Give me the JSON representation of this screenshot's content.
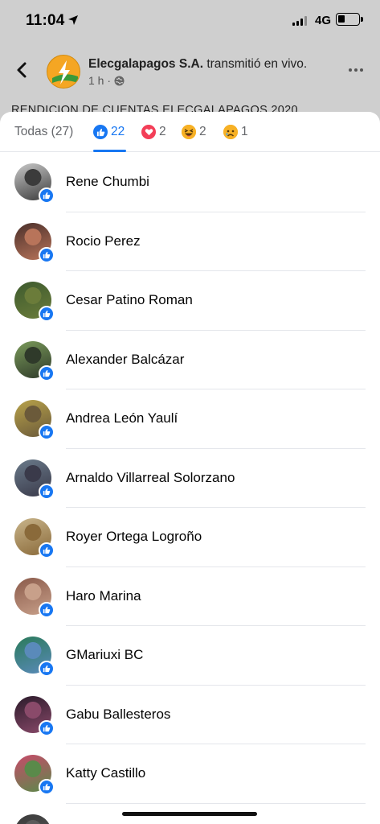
{
  "status_bar": {
    "time": "11:04",
    "network": "4G",
    "battery_level": 0.25
  },
  "post": {
    "page_name": "Elecgalapagos S.A.",
    "action": "transmitió en vivo.",
    "time_ago": "1 h ·",
    "caption": "RENDICION DE CUENTAS ELECGALAPAGOS 2020"
  },
  "tabs": {
    "all_label": "Todas (27)",
    "like_count": "22",
    "love_count": "2",
    "haha_count": "2",
    "sad_count": "1"
  },
  "colors": {
    "like": "#1877f2",
    "love": "#f33e58",
    "haha": "#f7b125"
  },
  "reactors": [
    {
      "name": "Rene Chumbi",
      "avatar_colors": [
        "#c9c9c9",
        "#3b3b3b"
      ],
      "reaction": "like"
    },
    {
      "name": "Rocio Perez",
      "avatar_colors": [
        "#4a2f2a",
        "#b8745a"
      ],
      "reaction": "like"
    },
    {
      "name": "Cesar Patino Roman",
      "avatar_colors": [
        "#3d5a2e",
        "#6b7c3a"
      ],
      "reaction": "like"
    },
    {
      "name": "Alexander Balcázar",
      "avatar_colors": [
        "#7a9a5a",
        "#2f3a2a"
      ],
      "reaction": "like"
    },
    {
      "name": "Andrea León Yaulí",
      "avatar_colors": [
        "#b8a24a",
        "#6b5a3a"
      ],
      "reaction": "like"
    },
    {
      "name": "Arnaldo Villarreal Solorzano",
      "avatar_colors": [
        "#6a7a8a",
        "#3a3a4a"
      ],
      "reaction": "like"
    },
    {
      "name": "Royer Ortega Logroño",
      "avatar_colors": [
        "#c8b48a",
        "#8a6a3a"
      ],
      "reaction": "like"
    },
    {
      "name": "Haro Marina",
      "avatar_colors": [
        "#8a5a4a",
        "#c8a08a"
      ],
      "reaction": "like"
    },
    {
      "name": "GMariuxi BC",
      "avatar_colors": [
        "#2a7a5a",
        "#5a8aba"
      ],
      "reaction": "like"
    },
    {
      "name": "Gabu Ballesteros",
      "avatar_colors": [
        "#2a1a2a",
        "#8a4a6a"
      ],
      "reaction": "like"
    },
    {
      "name": "Katty Castillo",
      "avatar_colors": [
        "#c84a6a",
        "#5a8a4a"
      ],
      "reaction": "like"
    },
    {
      "name": "",
      "avatar_colors": [
        "#3a3a3a",
        "#5a5a5a"
      ],
      "reaction": "like"
    }
  ]
}
